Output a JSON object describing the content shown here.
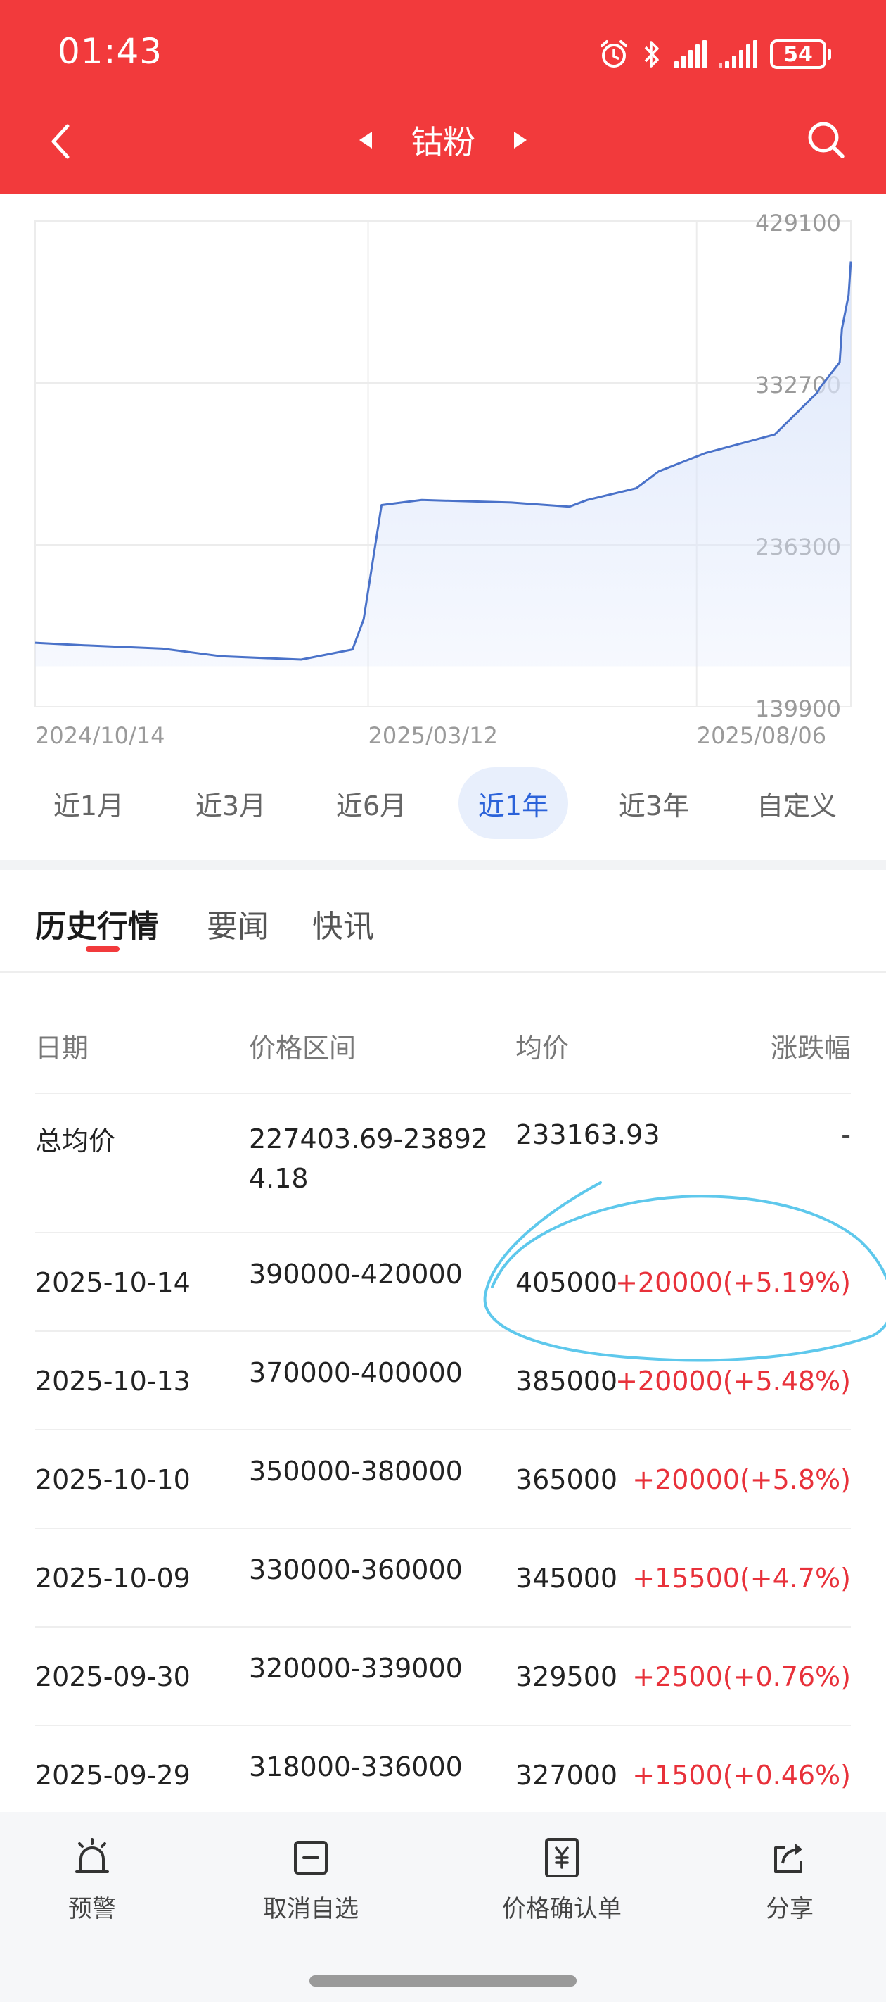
{
  "status_bar": {
    "time": "01:43",
    "battery": "54"
  },
  "nav": {
    "title": "钴粉"
  },
  "chart_data": {
    "type": "area",
    "x_ticks": [
      "2024/10/14",
      "2025/03/12",
      "2025/08/06"
    ],
    "y_ticks": [
      "429100",
      "332700",
      "236300",
      "139900"
    ],
    "ylim": [
      139900,
      429100
    ],
    "points": [
      [
        "2024/10/14",
        178000
      ],
      [
        "2024/11/05",
        176500
      ],
      [
        "2024/12/10",
        174500
      ],
      [
        "2025/01/05",
        170000
      ],
      [
        "2025/02/10",
        168000
      ],
      [
        "2025/03/05",
        174000
      ],
      [
        "2025/03/10",
        192000
      ],
      [
        "2025/03/18",
        260000
      ],
      [
        "2025/04/05",
        263000
      ],
      [
        "2025/05/15",
        261500
      ],
      [
        "2025/06/10",
        259000
      ],
      [
        "2025/06/18",
        263000
      ],
      [
        "2025/07/10",
        270000
      ],
      [
        "2025/07/20",
        280000
      ],
      [
        "2025/08/10",
        291000
      ],
      [
        "2025/09/10",
        302000
      ],
      [
        "2025/09/29",
        327000
      ],
      [
        "2025/09/30",
        329500
      ],
      [
        "2025/10/09",
        345000
      ],
      [
        "2025/10/10",
        365000
      ],
      [
        "2025/10/13",
        385000
      ],
      [
        "2025/10/14",
        405000
      ]
    ],
    "line_color": "#4a72c9",
    "fill_color": "#dce6fb",
    "grid": true
  },
  "range_tabs": [
    {
      "label": "近1月",
      "active": false
    },
    {
      "label": "近3月",
      "active": false
    },
    {
      "label": "近6月",
      "active": false
    },
    {
      "label": "近1年",
      "active": true
    },
    {
      "label": "近3年",
      "active": false
    },
    {
      "label": "自定义",
      "active": false
    }
  ],
  "content_tabs": [
    {
      "label": "历史行情",
      "active": true
    },
    {
      "label": "要闻",
      "active": false
    },
    {
      "label": "快讯",
      "active": false
    }
  ],
  "table": {
    "headers": [
      "日期",
      "价格区间",
      "均价",
      "涨跌幅"
    ],
    "summary": {
      "date": "总均价",
      "range": "227403.69-238924.18",
      "avg": "233163.93",
      "change": "-"
    },
    "rows": [
      {
        "date": "2025-10-14",
        "range": "390000-420000",
        "avg": "405000",
        "change": "+20000(+5.19%)"
      },
      {
        "date": "2025-10-13",
        "range": "370000-400000",
        "avg": "385000",
        "change": "+20000(+5.48%)"
      },
      {
        "date": "2025-10-10",
        "range": "350000-380000",
        "avg": "365000",
        "change": "+20000(+5.8%)"
      },
      {
        "date": "2025-10-09",
        "range": "330000-360000",
        "avg": "345000",
        "change": "+15500(+4.7%)"
      },
      {
        "date": "2025-09-30",
        "range": "320000-339000",
        "avg": "329500",
        "change": "+2500(+0.76%)"
      },
      {
        "date": "2025-09-29",
        "range": "318000-336000",
        "avg": "327000",
        "change": "+1500(+0.46%)"
      }
    ]
  },
  "bottom_bar": {
    "alert": "预警",
    "remove_watch": "取消自选",
    "price_confirm": "价格确认单",
    "share": "分享"
  },
  "colors": {
    "brand_red": "#f23a3c",
    "rise_red": "#e8313a",
    "active_blue": "#2b62d9",
    "annotation": "#5ec8ec"
  }
}
